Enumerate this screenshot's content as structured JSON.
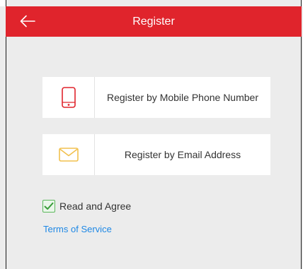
{
  "header": {
    "title": "Register",
    "back_icon": "arrow-left-icon"
  },
  "options": [
    {
      "label": "Register by Mobile Phone Number",
      "icon": "mobile-phone-icon"
    },
    {
      "label": "Register by Email Address",
      "icon": "envelope-icon"
    }
  ],
  "agreement": {
    "checked": true,
    "label": "Read and Agree",
    "link_text": "Terms of Service"
  },
  "colors": {
    "header": "#e0242c",
    "phone_icon": "#e0242c",
    "email_icon": "#f2c14e",
    "checkbox": "#5cb85c",
    "link": "#1e88e5"
  }
}
